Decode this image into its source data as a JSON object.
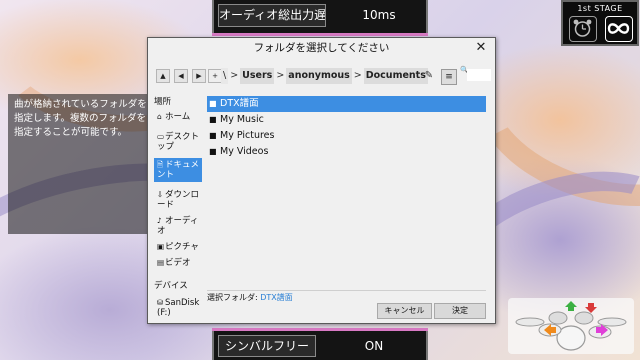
{
  "top_setting": {
    "label": "オーディオ総出力遅延",
    "value": "10ms"
  },
  "bottom_setting": {
    "label": "シンバルフリー",
    "value": "ON"
  },
  "description": "曲が格納されているフォルダを指定します。複数のフォルダを指定することが可能です。",
  "stage": {
    "title": "1st STAGE"
  },
  "dialog": {
    "title": "フォルダを選択してください",
    "close_label": "✕",
    "nav": {
      "up": "▲",
      "back": "◀",
      "forward": "▶",
      "new_folder": "+",
      "edit_icon": "✎",
      "view_icon": "≡",
      "search_icon": "🔍"
    },
    "breadcrumbs": [
      "\\",
      "Users",
      "anonymous",
      "Documents"
    ],
    "breadcrumb_separator": ">",
    "places_header": "場所",
    "places": [
      {
        "icon": "⌂",
        "label": "ホーム"
      },
      {
        "icon": "▭",
        "label": "デスクトップ"
      },
      {
        "icon": "🗎",
        "label": "ドキュメント"
      },
      {
        "icon": "⇩",
        "label": "ダウンロード"
      },
      {
        "icon": "♪",
        "label": "オーディオ"
      },
      {
        "icon": "▣",
        "label": "ピクチャ"
      },
      {
        "icon": "▤",
        "label": "ビデオ"
      }
    ],
    "devices_header": "デバイス",
    "devices": [
      {
        "icon": "⛁",
        "label": "SanDisk (F:)"
      }
    ],
    "folders": [
      "DTX譜面",
      "My Music",
      "My Pictures",
      "My Videos"
    ],
    "selected_folder_label": "選択フォルダ:",
    "selected_folder_value": "DTX譜面",
    "cancel_label": "キャンセル",
    "ok_label": "決定"
  },
  "colors": {
    "selection": "#3d8ee2",
    "accent_strip": "#d87ac4"
  }
}
